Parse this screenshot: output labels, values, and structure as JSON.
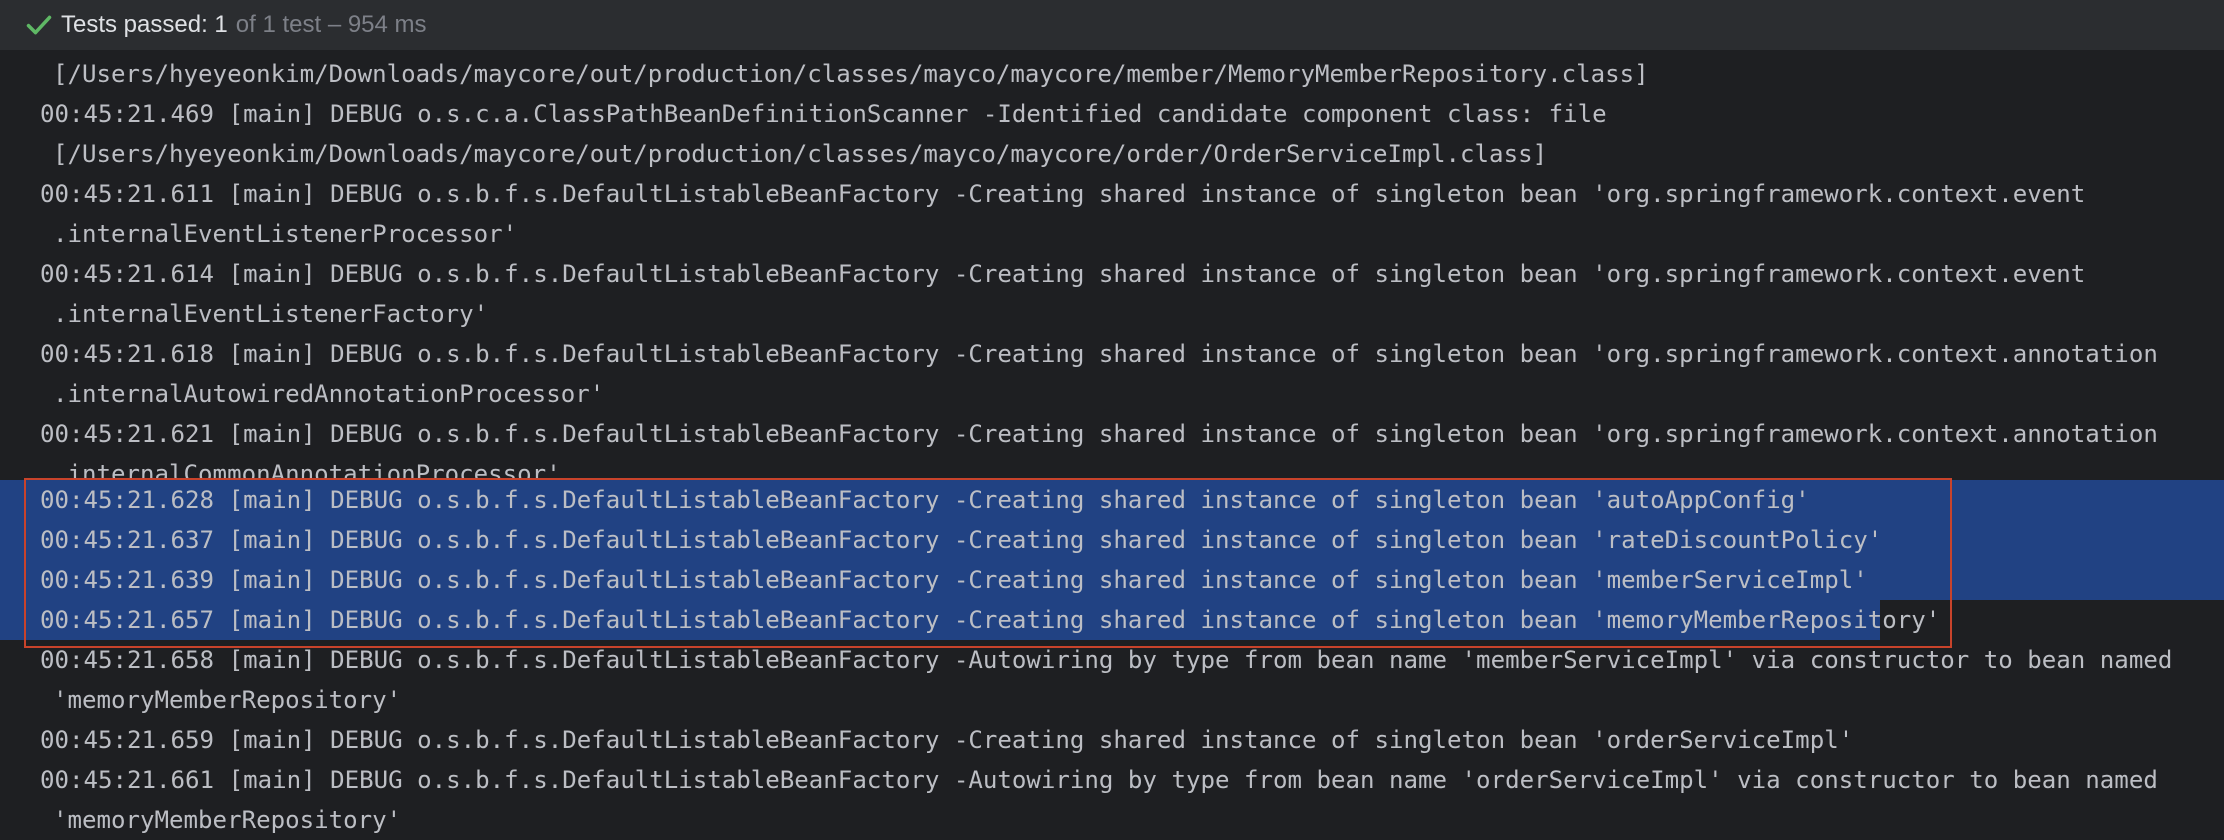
{
  "status": {
    "passed_label": "Tests passed: 1",
    "detail": "of 1 test – 954 ms",
    "icon": "check-icon",
    "accent_color": "#5fb865"
  },
  "console": {
    "lines": [
      "[/Users/hyeyeonkim/Downloads/maycore/out/production/classes/mayco/maycore/member/MemoryMemberRepository.class]",
      "00:45:21.469 [main] DEBUG o.s.c.a.ClassPathBeanDefinitionScanner -Identified candidate component class: file",
      "[/Users/hyeyeonkim/Downloads/maycore/out/production/classes/mayco/maycore/order/OrderServiceImpl.class]",
      "00:45:21.611 [main] DEBUG o.s.b.f.s.DefaultListableBeanFactory -Creating shared instance of singleton bean 'org.springframework.context.event",
      ".internalEventListenerProcessor'",
      "00:45:21.614 [main] DEBUG o.s.b.f.s.DefaultListableBeanFactory -Creating shared instance of singleton bean 'org.springframework.context.event",
      ".internalEventListenerFactory'",
      "00:45:21.618 [main] DEBUG o.s.b.f.s.DefaultListableBeanFactory -Creating shared instance of singleton bean 'org.springframework.context.annotation",
      ".internalAutowiredAnnotationProcessor'",
      "00:45:21.621 [main] DEBUG o.s.b.f.s.DefaultListableBeanFactory -Creating shared instance of singleton bean 'org.springframework.context.annotation",
      ".internalCommonAnnotationProcessor'",
      "00:45:21.628 [main] DEBUG o.s.b.f.s.DefaultListableBeanFactory -Creating shared instance of singleton bean 'autoAppConfig'",
      "00:45:21.637 [main] DEBUG o.s.b.f.s.DefaultListableBeanFactory -Creating shared instance of singleton bean 'rateDiscountPolicy'",
      "00:45:21.639 [main] DEBUG o.s.b.f.s.DefaultListableBeanFactory -Creating shared instance of singleton bean 'memberServiceImpl'",
      "00:45:21.657 [main] DEBUG o.s.b.f.s.DefaultListableBeanFactory -Creating shared instance of singleton bean 'memoryMemberRepository'",
      "00:45:21.658 [main] DEBUG o.s.b.f.s.DefaultListableBeanFactory -Autowiring by type from bean name 'memberServiceImpl' via constructor to bean named",
      "'memoryMemberRepository'",
      "00:45:21.659 [main] DEBUG o.s.b.f.s.DefaultListableBeanFactory -Creating shared instance of singleton bean 'orderServiceImpl'",
      "00:45:21.661 [main] DEBUG o.s.b.f.s.DefaultListableBeanFactory -Autowiring by type from bean name 'orderServiceImpl' via constructor to bean named",
      "'memoryMemberRepository'"
    ],
    "selection_color": "#214283",
    "highlight_box_color": "#c8432b"
  }
}
